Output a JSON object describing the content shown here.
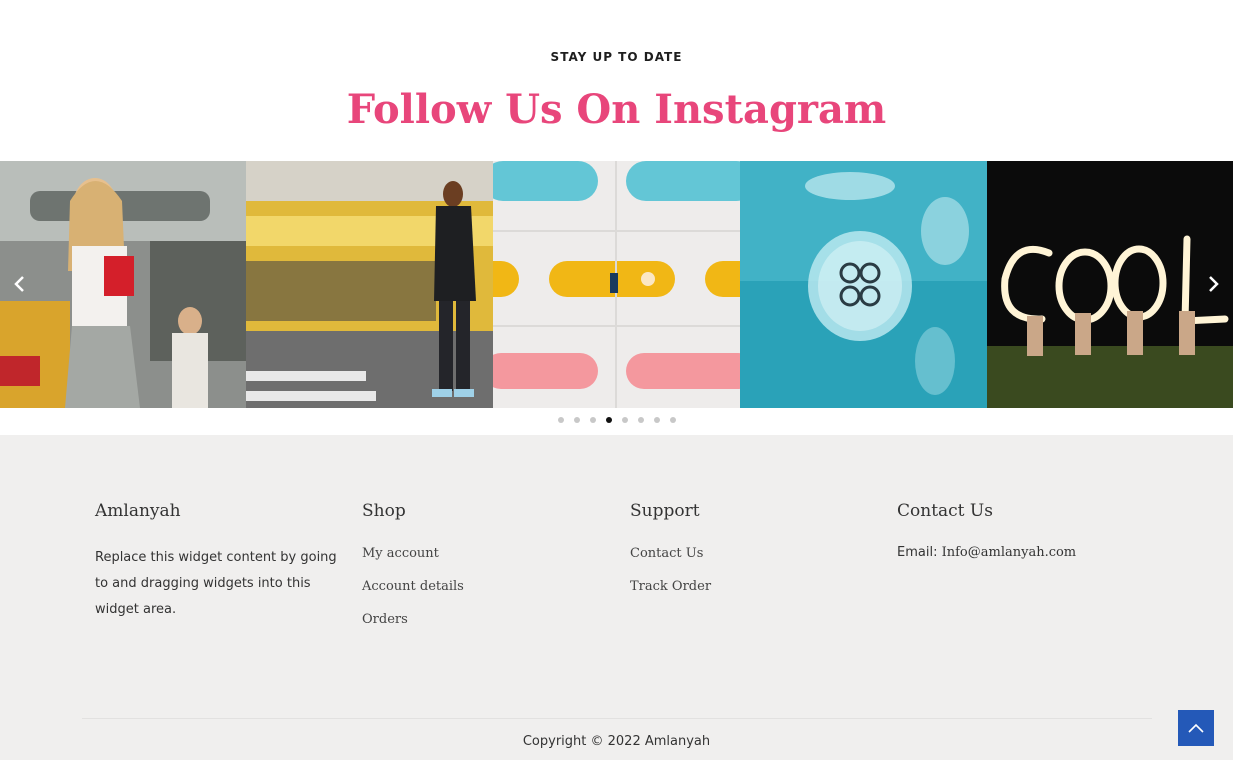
{
  "instagram": {
    "eyebrow": "STAY UP TO DATE",
    "title": "Follow Us On Instagram",
    "slides": [
      {
        "icon": "photo-woman-street"
      },
      {
        "icon": "photo-man-taxi"
      },
      {
        "icon": "photo-pastel-pills"
      },
      {
        "icon": "photo-jellyfish"
      },
      {
        "icon": "photo-sparkler-cool"
      }
    ],
    "dots_total": 8,
    "dots_active_index": 3
  },
  "footer": {
    "about": {
      "title": "Amlanyah",
      "text": "Replace this widget content by going to  and dragging widgets into this widget area."
    },
    "shop": {
      "title": "Shop",
      "links": [
        "My account",
        "Account details",
        "Orders"
      ]
    },
    "support": {
      "title": "Support",
      "links": [
        "Contact Us",
        "Track Order"
      ]
    },
    "contact": {
      "title": "Contact Us",
      "email_label": "Email:",
      "email": "Info@amlanyah.com"
    },
    "copyright": "Copyright © 2022 Amlanyah"
  },
  "colors": {
    "accent_pink": "#e8467b",
    "scroll_top_blue": "#2459b8",
    "footer_bg": "#f0efee"
  }
}
